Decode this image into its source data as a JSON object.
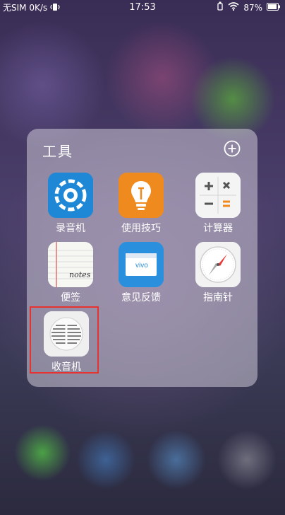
{
  "status_bar": {
    "carrier": "无SIM",
    "speed": "0K/s",
    "time": "17:53",
    "battery": "87%",
    "icons": [
      "usb-icon",
      "vibrate-icon",
      "battery-icon",
      "wifi-icon"
    ]
  },
  "folder": {
    "title": "工具",
    "add_icon": "plus-circle-icon",
    "apps": [
      {
        "label": "录音机",
        "icon": "recorder-icon",
        "color": "#1e88d6"
      },
      {
        "label": "使用技巧",
        "icon": "lightbulb-icon",
        "color": "#ef8a1f"
      },
      {
        "label": "计算器",
        "icon": "calculator-icon",
        "color": "#f4f4f4"
      },
      {
        "label": "便签",
        "icon": "notes-icon",
        "color": "#f6f6f2",
        "icon_text": "notes"
      },
      {
        "label": "意见反馈",
        "icon": "feedback-icon",
        "color": "#2a8fdc",
        "icon_text": "vivo"
      },
      {
        "label": "指南针",
        "icon": "compass-icon",
        "color": "#f2f2f2"
      },
      {
        "label": "收音机",
        "icon": "radio-icon",
        "color": "#efefef"
      }
    ],
    "highlighted_app": "收音机",
    "highlight_color": "#e8322f"
  }
}
